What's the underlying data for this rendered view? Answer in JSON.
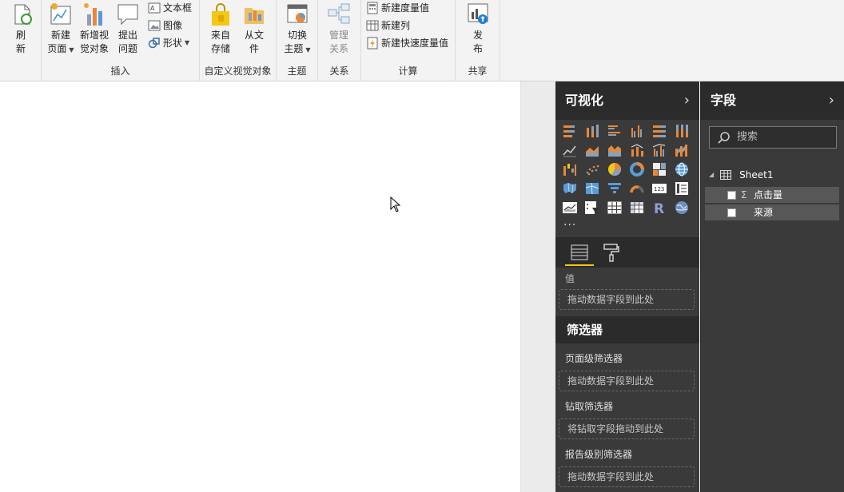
{
  "ribbon": {
    "refresh": "刷\n新",
    "new_page": "新建",
    "new_page_2": "页面",
    "new_visual": "新增视\n觉对象",
    "ask_question": "提出\n问题",
    "textbox": "文本框",
    "image": "图像",
    "shapes": "形状",
    "group_insert": "插入",
    "from_store": "来自\n存储",
    "from_file": "从文\n件",
    "group_custom_visuals": "自定义视觉对象",
    "switch_theme": "切换",
    "switch_theme_2": "主题",
    "group_theme": "主题",
    "manage_rel": "管理\n关系",
    "group_relationships": "关系",
    "new_measure": "新建度量值",
    "new_column": "新建列",
    "new_quick_measure": "新建快速度量值",
    "group_calculations": "计算",
    "publish": "发\n布",
    "group_share": "共享"
  },
  "visualizations": {
    "title": "可视化",
    "more": "···",
    "values_label": "值",
    "values_drop": "拖动数据字段到此处"
  },
  "filters": {
    "title": "筛选器",
    "page_level": "页面级筛选器",
    "page_drop": "拖动数据字段到此处",
    "drillthrough": "钻取筛选器",
    "drillthrough_drop": "将钻取字段拖动到此处",
    "report_level": "报告级别筛选器",
    "report_drop": "拖动数据字段到此处"
  },
  "fields": {
    "title": "字段",
    "search_placeholder": "搜索",
    "table_name": "Sheet1",
    "items": [
      {
        "name": "点击量",
        "sigma": "Σ"
      },
      {
        "name": "来源",
        "sigma": ""
      }
    ]
  },
  "colors": {
    "accent": "#f2c811",
    "orange": "#e8883a",
    "blue": "#5b9bd5",
    "pane_bg": "#3a3a3a"
  }
}
